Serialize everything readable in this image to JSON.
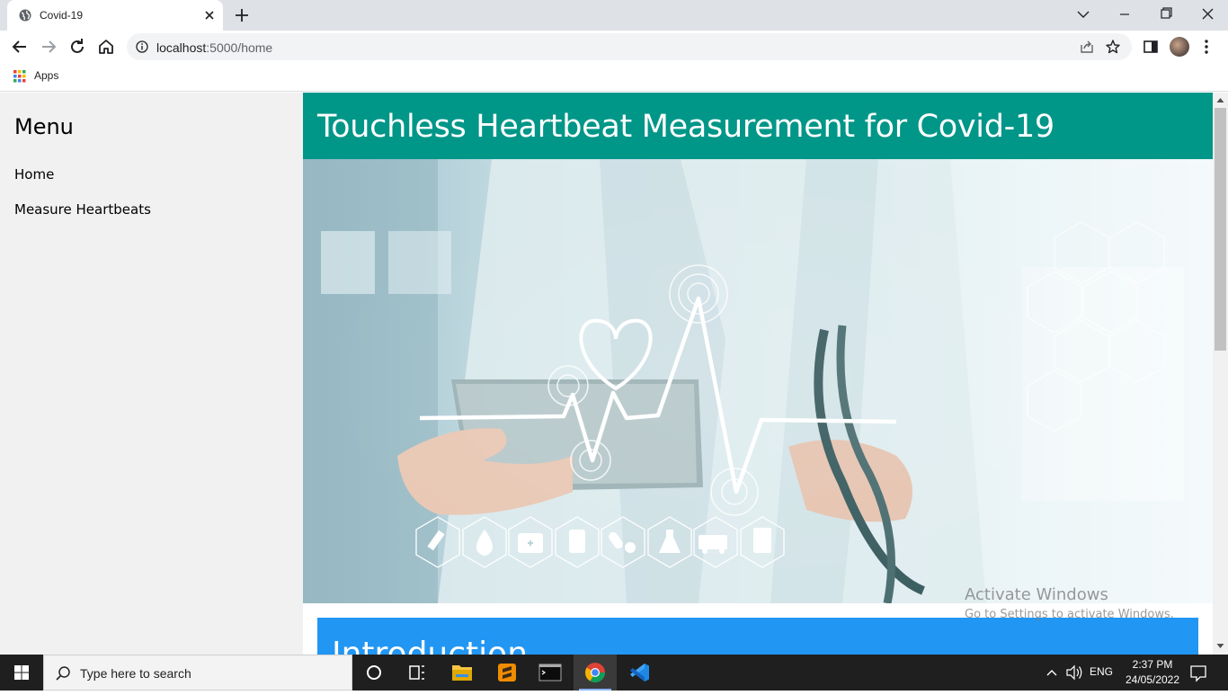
{
  "browser": {
    "tab_title": "Covid-19",
    "url_host": "localhost",
    "url_rest": ":5000/home",
    "bookmarks_apps": "Apps"
  },
  "sidebar": {
    "title": "Menu",
    "links": [
      {
        "label": "Home"
      },
      {
        "label": "Measure Heartbeats"
      }
    ]
  },
  "page": {
    "header_title": "Touchless Heartbeat Measurement for Covid-19",
    "intro_heading": "Introduction",
    "hero_icons": [
      "syringe-icon",
      "drop-icon",
      "first-aid-icon",
      "blood-bag-icon",
      "pills-icon",
      "flask-icon",
      "ambulance-icon",
      "clipboard-icon"
    ]
  },
  "watermark": {
    "line1": "Activate Windows",
    "line2": "Go to Settings to activate Windows."
  },
  "taskbar": {
    "search_placeholder": "Type here to search",
    "language": "ENG",
    "time": "2:37 PM",
    "date": "24/05/2022"
  },
  "colors": {
    "header_teal": "#009688",
    "intro_blue": "#2196f3",
    "sidebar_bg": "#f1f1f1"
  }
}
